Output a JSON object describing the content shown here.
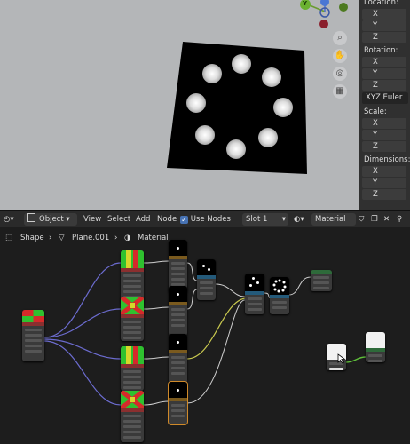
{
  "props": {
    "location_label": "Location:",
    "rotation_label": "Rotation:",
    "rotation_mode": "XYZ Euler",
    "scale_label": "Scale:",
    "dimensions_label": "Dimensions:",
    "axis_x": "X",
    "axis_y": "Y",
    "axis_z": "Z"
  },
  "header": {
    "mode": "Object",
    "menus": [
      "View",
      "Select",
      "Add",
      "Node"
    ],
    "use_nodes": "Use Nodes",
    "slot": "Slot 1",
    "material": "Material"
  },
  "breadcrumb": [
    "Shape",
    "Plane.001",
    "Material"
  ],
  "gizmo_axis": "Y",
  "colors": {
    "viewport_bg": "#b4b6b8",
    "editor_bg": "#1d1d1d",
    "panel_bg": "#303030",
    "link_blue": "#6c6cd0",
    "link_yellow": "#c9c94f",
    "link_green": "#5fbf3a",
    "accent": "#4772b3"
  }
}
